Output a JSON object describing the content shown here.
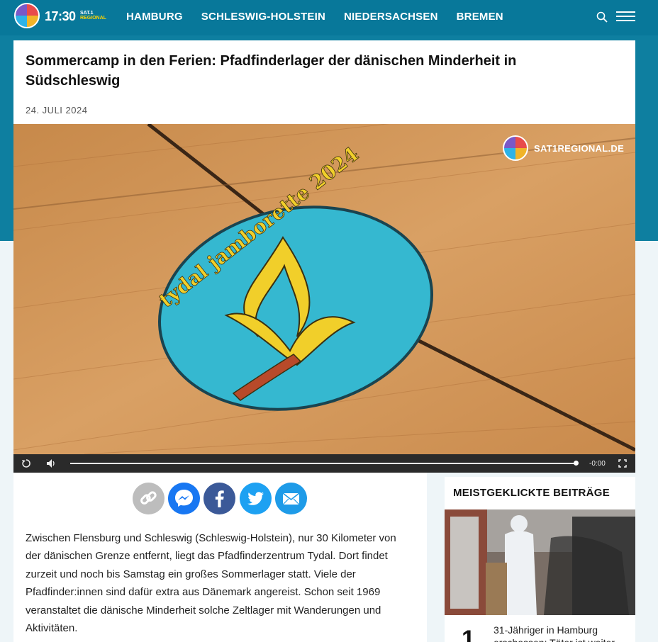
{
  "header": {
    "logo_time": "17:30",
    "logo_sat_top": "SAT.1",
    "logo_sat_bottom": "REGIONAL",
    "nav": [
      "HAMBURG",
      "SCHLESWIG-HOLSTEIN",
      "NIEDERSACHSEN",
      "BREMEN"
    ],
    "search_icon": "search-icon",
    "menu_icon": "hamburger-menu-icon",
    "brand_color": "#0e7fa0"
  },
  "article": {
    "title": "Sommercamp in den Ferien: Pfadfinderlager der dänischen Minderheit in Südschleswig",
    "date": "24. JULI 2024"
  },
  "video": {
    "watermark": "SAT1REGIONAL.DE",
    "patch_text": "tydal jamborette 2024",
    "time": "-0:00",
    "progress": 1.0,
    "controls": [
      "replay-icon",
      "volume-icon",
      "fullscreen-icon"
    ]
  },
  "share": {
    "buttons": [
      {
        "name": "copy-link",
        "color": "#bbbbbb"
      },
      {
        "name": "messenger",
        "color": "#1877f2"
      },
      {
        "name": "facebook",
        "color": "#3b5998"
      },
      {
        "name": "twitter",
        "color": "#1da1f2"
      },
      {
        "name": "email",
        "color": "#1e9be8"
      }
    ]
  },
  "body": {
    "paragraph": "Zwischen Flensburg und Schleswig (Schleswig-Holstein), nur 30 Kilometer von der dänischen Grenze entfernt, liegt das Pfadfinderzentrum Tydal. Dort findet zurzeit und noch bis Samstag ein großes Sommerlager statt. Viele der Pfadfinder:innen sind dafür extra aus Dänemark angereist. Schon seit 1969 veranstaltet die dänische Minderheit solche Zeltlager mit Wanderungen und Aktivitäten."
  },
  "sidebar": {
    "title": "MEISTGEKLICKTE BEITRÄGE",
    "items": [
      {
        "rank": "1",
        "text": "31-Jähriger in Hamburg erschossen: Täter ist weiter"
      }
    ]
  }
}
